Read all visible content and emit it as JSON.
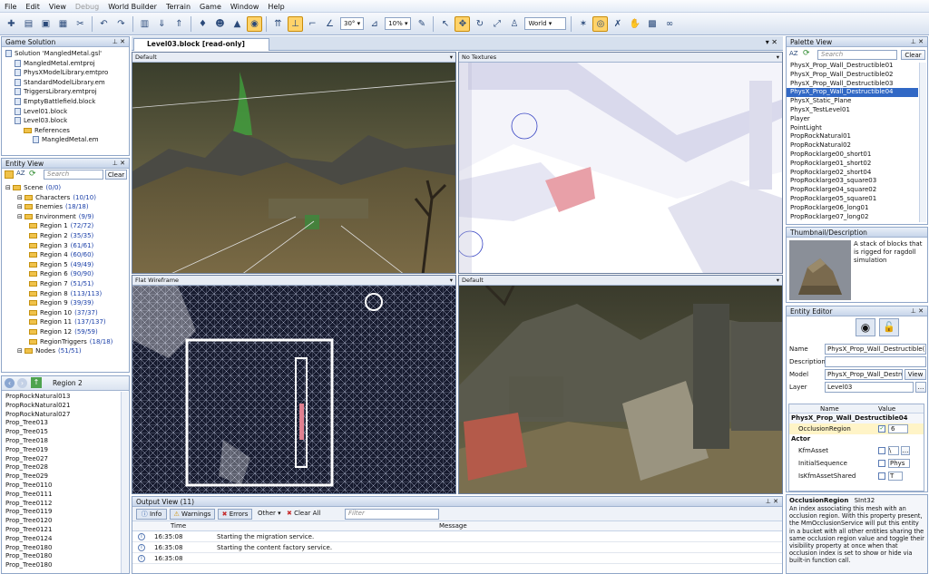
{
  "menu": [
    "File",
    "Edit",
    "View",
    "Debug",
    "World Builder",
    "Terrain",
    "Game",
    "Window",
    "Help"
  ],
  "menu_disabled": "Debug",
  "toolbar": {
    "angle": "30°",
    "percent": "10%",
    "space": "World"
  },
  "game_solution": {
    "title": "Game Solution",
    "items": [
      {
        "label": "Solution 'MangledMetal.gsl'",
        "indent": 0,
        "icon": "solution"
      },
      {
        "label": "MangledMetal.emtproj",
        "indent": 1,
        "icon": "doc"
      },
      {
        "label": "PhysXModelLibrary.emtpro",
        "indent": 1,
        "icon": "doc"
      },
      {
        "label": "StandardModelLibrary.em",
        "indent": 1,
        "icon": "doc"
      },
      {
        "label": "TriggersLibrary.emtproj",
        "indent": 1,
        "icon": "doc"
      },
      {
        "label": "EmptyBattlefield.block",
        "indent": 1,
        "icon": "doc"
      },
      {
        "label": "Level01.block",
        "indent": 1,
        "icon": "doc"
      },
      {
        "label": "Level03.block",
        "indent": 1,
        "icon": "doc"
      },
      {
        "label": "References",
        "indent": 2,
        "icon": "folder"
      },
      {
        "label": "MangledMetal.em",
        "indent": 3,
        "icon": "doc"
      }
    ]
  },
  "entity_view": {
    "title": "Entity View",
    "search_placeholder": "Search",
    "clear_label": "Clear",
    "items": [
      {
        "name": "Scene",
        "count": "(0/0)",
        "indent": 0
      },
      {
        "name": "Characters",
        "count": "(10/10)",
        "indent": 1
      },
      {
        "name": "Enemies",
        "count": "(18/18)",
        "indent": 1
      },
      {
        "name": "Environment",
        "count": "(9/9)",
        "indent": 1
      },
      {
        "name": "Region 1",
        "count": "(72/72)",
        "indent": 2
      },
      {
        "name": "Region 2",
        "count": "(35/35)",
        "indent": 2
      },
      {
        "name": "Region 3",
        "count": "(61/61)",
        "indent": 2
      },
      {
        "name": "Region 4",
        "count": "(60/60)",
        "indent": 2
      },
      {
        "name": "Region 5",
        "count": "(49/49)",
        "indent": 2
      },
      {
        "name": "Region 6",
        "count": "(90/90)",
        "indent": 2
      },
      {
        "name": "Region 7",
        "count": "(51/51)",
        "indent": 2
      },
      {
        "name": "Region 8",
        "count": "(113/113)",
        "indent": 2
      },
      {
        "name": "Region 9",
        "count": "(39/39)",
        "indent": 2
      },
      {
        "name": "Region 10",
        "count": "(37/37)",
        "indent": 2
      },
      {
        "name": "Region 11",
        "count": "(137/137)",
        "indent": 2
      },
      {
        "name": "Region 12",
        "count": "(59/59)",
        "indent": 2
      },
      {
        "name": "RegionTriggers",
        "count": "(18/18)",
        "indent": 2
      },
      {
        "name": "Nodes",
        "count": "(51/51)",
        "indent": 1
      }
    ]
  },
  "region_list": {
    "title": "Region 2",
    "items": [
      "PropRockNatural013",
      "PropRockNatural021",
      "PropRockNatural027",
      "Prop_Tree013",
      "Prop_Tree015",
      "Prop_Tree018",
      "Prop_Tree019",
      "Prop_Tree027",
      "Prop_Tree028",
      "Prop_Tree029",
      "Prop_Tree0110",
      "Prop_Tree0111",
      "Prop_Tree0112",
      "Prop_Tree0119",
      "Prop_Tree0120",
      "Prop_Tree0121",
      "Prop_Tree0124",
      "Prop_Tree0180",
      "Prop_Tree0180",
      "Prop_Tree0180"
    ]
  },
  "document_tab": "Level03.block [read-only]",
  "viewports": [
    {
      "label": "Default"
    },
    {
      "label": "No Textures"
    },
    {
      "label": "Flat Wireframe"
    },
    {
      "label": "Default"
    }
  ],
  "output": {
    "title": "Output View (11)",
    "info": "Info",
    "warnings": "Warnings",
    "errors": "Errors",
    "other": "Other",
    "clear_all": "Clear All",
    "filter_placeholder": "Filter",
    "col_time": "Time",
    "col_message": "Message",
    "rows": [
      {
        "time": "16:35:08",
        "message": "Starting the migration service."
      },
      {
        "time": "16:35:08",
        "message": "Starting the content factory service."
      },
      {
        "time": "16:35:08",
        "message": ""
      }
    ]
  },
  "palette": {
    "title": "Palette View",
    "search_placeholder": "Search",
    "clear_label": "Clear",
    "items": [
      "PhysX_Prop_Wall_Destructible01",
      "PhysX_Prop_Wall_Destructible02",
      "PhysX_Prop_Wall_Destructible03",
      "PhysX_Prop_Wall_Destructible04",
      "PhysX_Static_Plane",
      "PhysX_TestLevel01",
      "Player",
      "PointLight",
      "PropRockNatural01",
      "PropRockNatural02",
      "PropRocklarge00_short01",
      "PropRocklarge01_short02",
      "PropRocklarge02_short04",
      "PropRocklarge03_square03",
      "PropRocklarge04_square02",
      "PropRocklarge05_square01",
      "PropRocklarge06_long01",
      "PropRocklarge07_long02"
    ],
    "selected_index": 3
  },
  "thumbnail": {
    "title": "Thumbnail/Description",
    "description": "A stack of blocks that is rigged for ragdoll simulation"
  },
  "entity_editor": {
    "title": "Entity Editor",
    "name_label": "Name",
    "name_value": "PhysX_Prop_Wall_Destructible(",
    "description_label": "Description",
    "model_label": "Model",
    "model_value": "PhysX_Prop_Wall_Destru",
    "view_label": "View",
    "layer_label": "Layer",
    "layer_value": "Level03",
    "grid_col_name": "Name",
    "grid_col_value": "Value",
    "entity_name": "PhysX_Prop_Wall_Destructible04",
    "occlusion_label": "OcclusionRegion",
    "occlusion_value": "6",
    "actor_label": "Actor",
    "kfm_label": "KfmAsset",
    "kfm_value": "\\",
    "initial_label": "InitialSequence",
    "initial_value": "Phys",
    "shared_label": "IsKfmAssetShared",
    "shared_value": "T"
  },
  "help": {
    "heading": "OcclusionRegion",
    "type": "SInt32",
    "text": "An index associating this mesh with an occlusion region. With this property present, the MmOcclusionService will put this entity in a bucket with all other entities sharing the same occlusion region value and toggle their visibility property at once when that occlusion index is set to show or hide via built-in function call."
  },
  "colors": {
    "accent": "#3168c5",
    "chrome": "#d8e2f0",
    "selection_bg": "#3168c5",
    "count_text": "#1a3fa8"
  }
}
